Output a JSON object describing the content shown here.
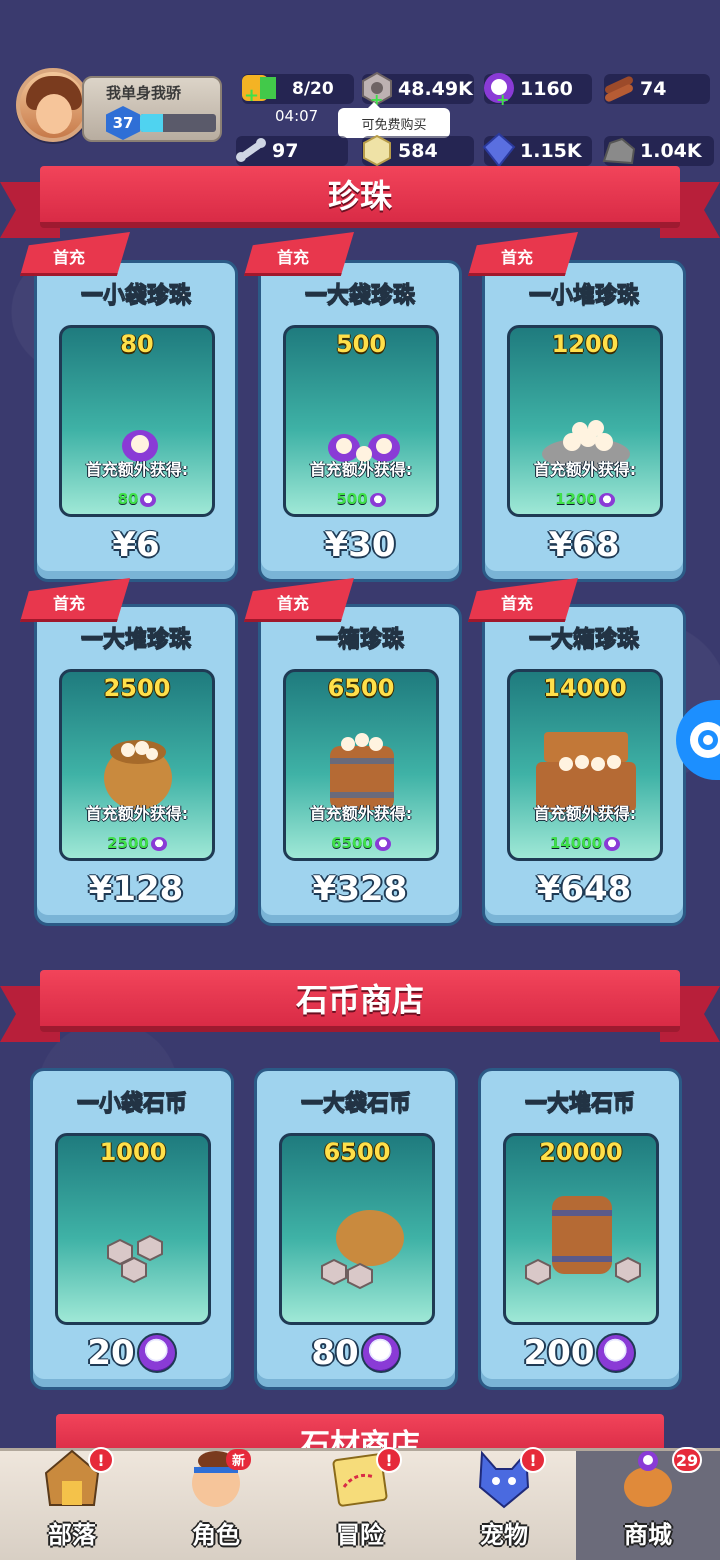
{
  "header": {
    "player_name": "我单身我骄",
    "level": "37",
    "xp_progress": 0.3,
    "energy": "8/20",
    "timer": "04:07",
    "tooltip": "可免费购买",
    "resources_row1": [
      {
        "icon": "nut-coin-icon",
        "value": "48.49K"
      },
      {
        "icon": "pearl-icon",
        "value": "1160"
      },
      {
        "icon": "wood-icon",
        "value": "74"
      }
    ],
    "resources_row2": [
      {
        "icon": "bone-icon",
        "value": "97"
      },
      {
        "icon": "shell-icon",
        "value": "584"
      },
      {
        "icon": "crystal-icon",
        "value": "1.15K"
      },
      {
        "icon": "stone-icon",
        "value": "1.04K"
      }
    ]
  },
  "sections": {
    "pearl": "珍珠",
    "stone_coin": "石币商店",
    "stone_material": "石材商店"
  },
  "first_tag": "首充",
  "bonus_label": "首充额外获得:",
  "pearl_products": [
    {
      "name": "一小袋珍珠",
      "qty": "80",
      "bonus": "80",
      "price": "¥6"
    },
    {
      "name": "一大袋珍珠",
      "qty": "500",
      "bonus": "500",
      "price": "¥30"
    },
    {
      "name": "一小堆珍珠",
      "qty": "1200",
      "bonus": "1200",
      "price": "¥68"
    },
    {
      "name": "一大堆珍珠",
      "qty": "2500",
      "bonus": "2500",
      "price": "¥128"
    },
    {
      "name": "一箱珍珠",
      "qty": "6500",
      "bonus": "6500",
      "price": "¥328"
    },
    {
      "name": "一大箱珍珠",
      "qty": "14000",
      "bonus": "14000",
      "price": "¥648"
    }
  ],
  "coin_products": [
    {
      "name": "一小袋石币",
      "qty": "1000",
      "price": "20"
    },
    {
      "name": "一大袋石币",
      "qty": "6500",
      "price": "80"
    },
    {
      "name": "一大堆石币",
      "qty": "20000",
      "price": "200"
    }
  ],
  "tabs": [
    {
      "label": "部落",
      "icon": "tribe-icon",
      "badge": "!"
    },
    {
      "label": "角色",
      "icon": "character-icon",
      "badge": "新"
    },
    {
      "label": "冒险",
      "icon": "adventure-map-icon",
      "badge": "!"
    },
    {
      "label": "宠物",
      "icon": "pet-icon",
      "badge": "!"
    },
    {
      "label": "商城",
      "icon": "shop-bag-icon",
      "badge": "29",
      "active": true
    }
  ],
  "colors": {
    "background": "#3a3a6e",
    "banner_red": "#e8374d",
    "card_blue": "#9fd3ee",
    "qty_yellow": "#ffe04a",
    "bonus_green": "#3fe04a"
  }
}
